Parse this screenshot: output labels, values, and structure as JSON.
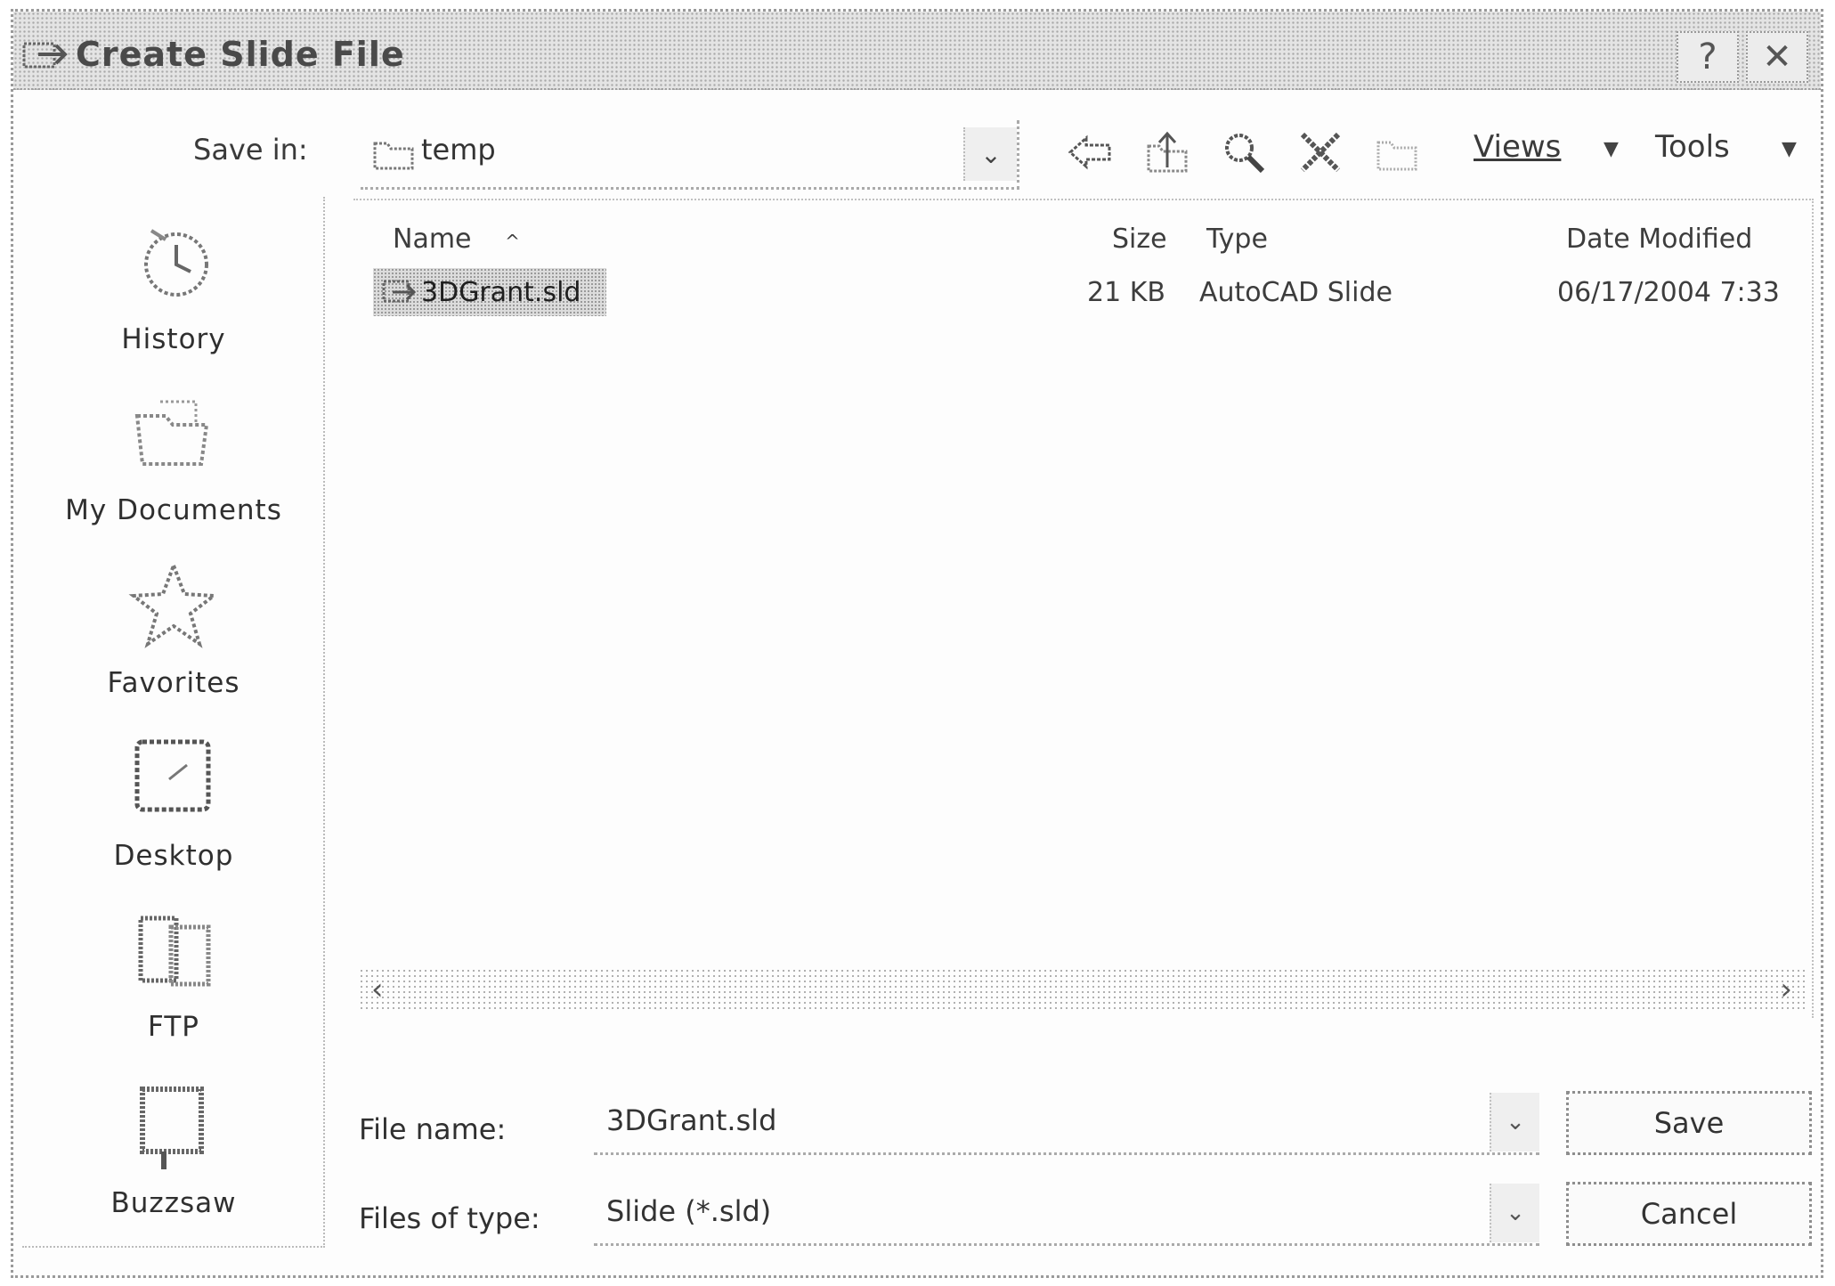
{
  "window": {
    "title": "Create Slide File",
    "help_label": "?",
    "close_label": "✕"
  },
  "toolbar": {
    "save_in_label": "Save in:",
    "save_in_value": "temp",
    "views_label": "Views",
    "tools_label": "Tools"
  },
  "places": [
    {
      "label": "History",
      "icon": "history-icon"
    },
    {
      "label": "My Documents",
      "icon": "my-documents-icon"
    },
    {
      "label": "Favorites",
      "icon": "favorites-icon"
    },
    {
      "label": "Desktop",
      "icon": "desktop-icon"
    },
    {
      "label": "FTP",
      "icon": "ftp-icon"
    },
    {
      "label": "Buzzsaw",
      "icon": "buzzsaw-icon"
    }
  ],
  "filelist": {
    "columns": [
      "Name",
      "Size",
      "Type",
      "Date Modified"
    ],
    "rows": [
      {
        "name": "3DGrant.sld",
        "size": "21 KB",
        "type": "AutoCAD Slide",
        "date": "06/17/2004 7:33"
      }
    ]
  },
  "form": {
    "file_name_label": "File name:",
    "file_name_value": "3DGrant.sld",
    "file_type_label": "Files of type:",
    "file_type_value": "Slide (*.sld)",
    "save_label": "Save",
    "cancel_label": "Cancel"
  }
}
